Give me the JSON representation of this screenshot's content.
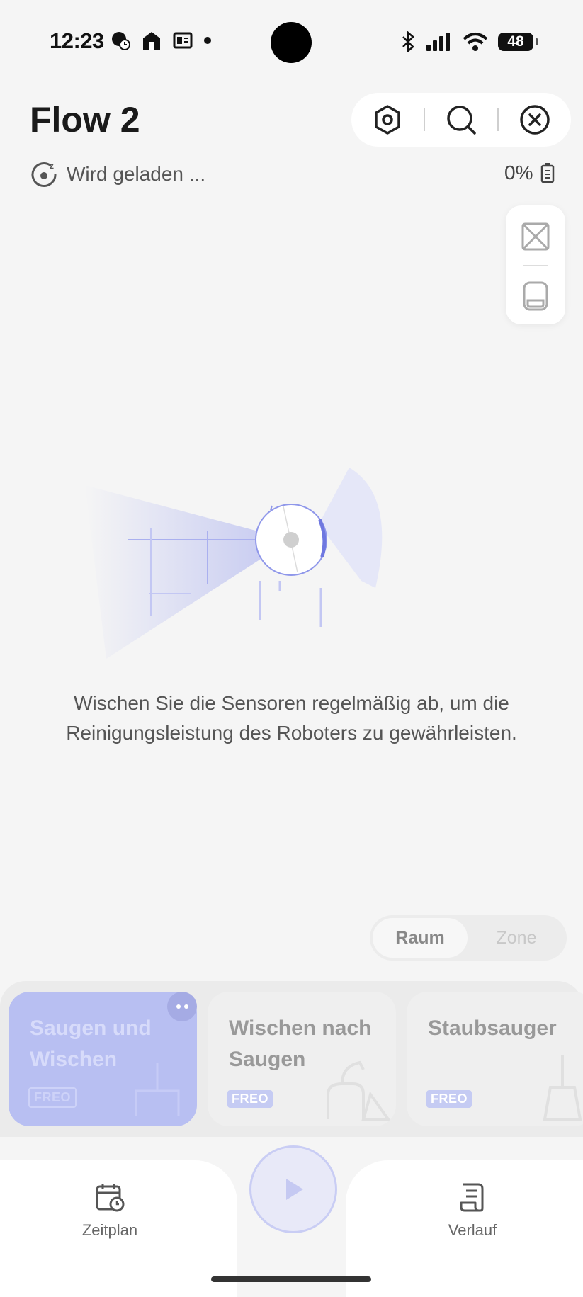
{
  "status_bar": {
    "time": "12:23",
    "battery_level": "48"
  },
  "header": {
    "title": "Flow 2",
    "status_text": "Wird geladen ...",
    "battery_percent": "0%",
    "icons": [
      "settings-hexagon-icon",
      "search-icon",
      "close-circle-icon"
    ]
  },
  "side_panel": {
    "icons": [
      "map-no-image-icon",
      "dock-station-icon"
    ]
  },
  "hint": {
    "text": "Wischen Sie die Sensoren regelmäßig ab, um die Reinigungsleistung des Roboters zu gewährleisten."
  },
  "mode_toggle": {
    "options": [
      "Raum",
      "Zone"
    ],
    "selected": "Raum"
  },
  "modes": [
    {
      "label": "Saugen und Wischen",
      "badge": "FREO",
      "selected": true
    },
    {
      "label": "Wischen nach Saugen",
      "badge": "FREO",
      "selected": false
    },
    {
      "label": "Staubsauger",
      "badge": "FREO",
      "selected": false
    }
  ],
  "nav": {
    "schedule_label": "Zeitplan",
    "history_label": "Verlauf"
  },
  "colors": {
    "accent": "#8f97ea",
    "accent_light": "#b8bff2",
    "background": "#f5f5f5"
  }
}
